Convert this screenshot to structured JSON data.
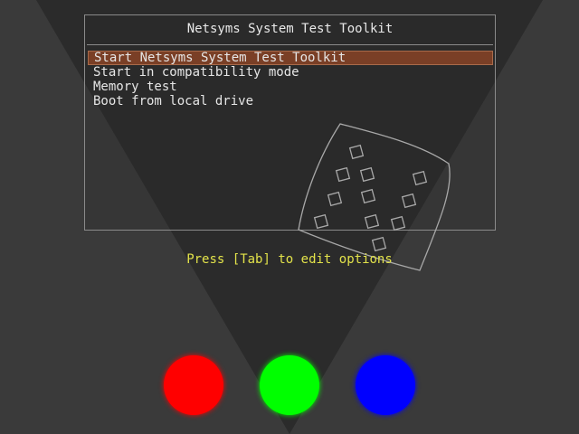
{
  "boot_menu": {
    "title": "Netsyms System Test Toolkit",
    "items": [
      {
        "label": "Start Netsyms System Test Toolkit",
        "selected": true
      },
      {
        "label": "Start in compatibility mode",
        "selected": false
      },
      {
        "label": "Memory test",
        "selected": false
      },
      {
        "label": "Boot from local drive",
        "selected": false
      }
    ],
    "hint": "Press [Tab] to edit options"
  },
  "colors": {
    "background": "#3a3a3a",
    "spotlight": "#2a2a2a",
    "selection": "#7a3f26",
    "hint_text": "#e2e24a",
    "menu_text": "#e6e6e6"
  },
  "indicator_lights": [
    {
      "name": "red-light",
      "color": "#ff0000"
    },
    {
      "name": "green-light",
      "color": "#00ff00"
    },
    {
      "name": "blue-light",
      "color": "#0000ff"
    }
  ]
}
